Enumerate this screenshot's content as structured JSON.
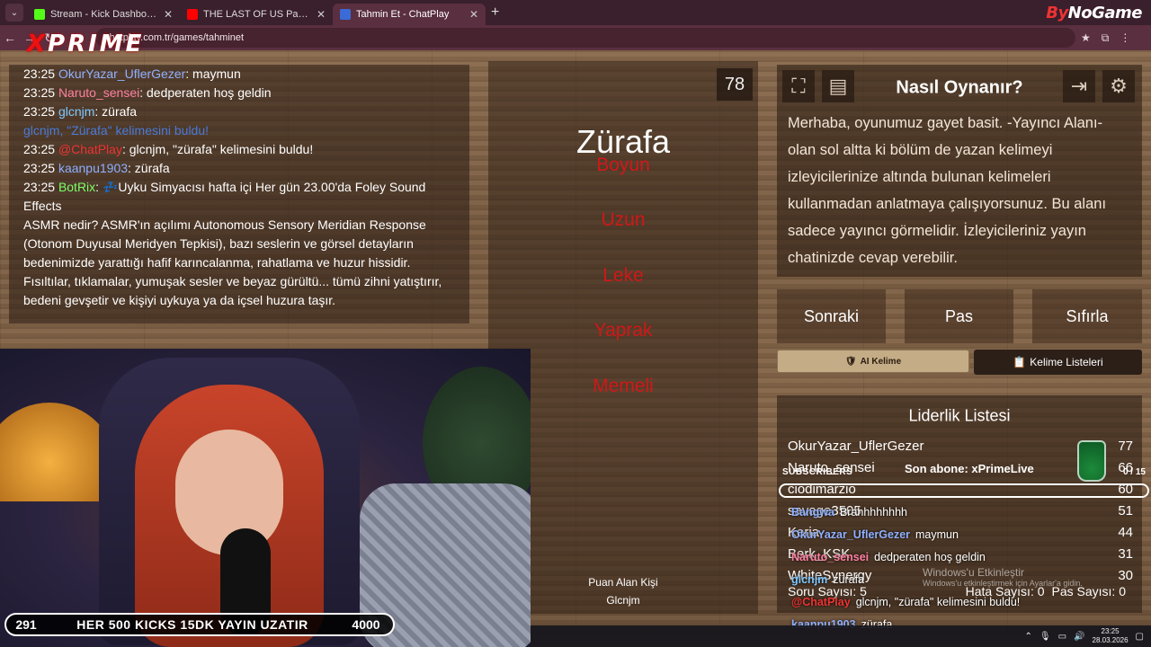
{
  "browser": {
    "tabs": [
      {
        "label": "Stream - Kick Dashboard",
        "icon": "kick-icon",
        "color": "#53fc18",
        "active": false
      },
      {
        "label": "THE LAST OF US Part II Am",
        "icon": "youtube-icon",
        "color": "#ff0000",
        "active": false
      },
      {
        "label": "Tahmin Et - ChatPlay",
        "icon": "chatplay-icon",
        "color": "#3a6bd8",
        "active": true
      }
    ],
    "url": "chatplay.com.tr/games/tahminet",
    "brand_prefix": "By",
    "brand_suffix": "NoGame"
  },
  "overlay_logo": {
    "x": "X",
    "rest": "PRIME"
  },
  "chat": [
    {
      "time": "23:25",
      "user": "OkurYazar_UflerGezer",
      "color": "#8fb0ff",
      "text": ": maymun"
    },
    {
      "time": "23:25",
      "user": "Naruto_sensei",
      "color": "#ff7fa0",
      "text": ": dedperaten hoş geldin"
    },
    {
      "time": "23:25",
      "user": "glcnjm",
      "color": "#7fc8ff",
      "text": ": zürafa"
    },
    {
      "time": "",
      "user": "glcnjm, \"Zürafa\" kelimesini buldu!",
      "color": "#4a7ad8",
      "text": ""
    },
    {
      "time": "23:25",
      "user": "@ChatPlay",
      "color": "#e33",
      "text": ": glcnjm, \"zürafa\" kelimesini buldu!"
    },
    {
      "time": "23:25",
      "user": "kaanpu1903",
      "color": "#8fb0ff",
      "text": ": zürafa"
    },
    {
      "time": "23:25",
      "user": "BotRix",
      "color": "#7dff6a",
      "text": ": 💤Uyku Simyacısı hafta içi Her gün 23.00'da Foley Sound Effects"
    },
    {
      "time": "",
      "user": "",
      "color": "#fff",
      "text": "ASMR nedir? ASMR'ın açılımı Autonomous Sensory Meridian Response (Otonom Duyusal Meridyen Tepkisi), bazı seslerin ve görsel detayların bedenimizde yarattığı hafif karıncalanma, rahatlama ve huzur hissidir. Fısıltılar, tıklamalar, yumuşak sesler ve beyaz gürültü... tümü zihni yatıştırır, bedeni gevşetir ve kişiyi uykuya ya da içsel huzura taşır."
    }
  ],
  "game": {
    "count": "78",
    "word": "Zürafa",
    "taboo": [
      "Boyun",
      "Uzun",
      "Leke",
      "Yaprak",
      "Memeli"
    ],
    "point_label": "Puan Alan Kişi",
    "point_user": "Glcnjm"
  },
  "howto": {
    "title": "Nasıl Oynanır?",
    "text": "Merhaba, oyunumuz gayet basit. -Yayıncı Alanı- olan sol altta ki bölüm de yazan kelimeyi izleyicilerinize altında bulunan kelimeleri kullanmadan anlatmaya çalışıyorsunuz. Bu alanı sadece yayıncı görmelidir. İzleyicileriniz yayın chatinizde cevap verebilir."
  },
  "buttons": {
    "next": "Sonraki",
    "pass": "Pas",
    "reset": "Sıfırla",
    "ai_word": "AI Kelime",
    "word_lists": "Kelime Listeleri"
  },
  "leaderboard": {
    "title": "Liderlik Listesi",
    "rows": [
      {
        "name": "OkurYazar_UflerGezer",
        "score": "77"
      },
      {
        "name": "Naruto_sensei",
        "score": "66"
      },
      {
        "name": "ciodimarzio",
        "score": "60"
      },
      {
        "name": "savage3505",
        "score": "51"
      },
      {
        "name": "Keria",
        "score": "44"
      },
      {
        "name": "Berk_KSK",
        "score": "31"
      },
      {
        "name": "WhiteSynergy",
        "score": "30"
      }
    ],
    "question_count": "Soru Sayısı: 5",
    "error_count": "Hata Sayısı: 0",
    "pass_count": "Pas Sayısı: 0"
  },
  "stream_overlay": {
    "kick_left": "291",
    "kick_text": "HER 500 KICKS 15DK YAYIN UZATIR",
    "kick_right": "4000",
    "subs_label": "SUBSCRIBERS",
    "last_sub": "Son abone: xPrimeLive",
    "subs_count": "0 / 15",
    "chat": [
      {
        "user": "Bangwa",
        "color": "#8fb0ff",
        "text": "Brahhhhhhhh"
      },
      {
        "user": "OkurYazar_UflerGezer",
        "color": "#8fb0ff",
        "text": "maymun"
      },
      {
        "user": "Naruto_sensei",
        "color": "#ff7fa0",
        "text": "dedperaten hoş geldin"
      },
      {
        "user": "glcnjm",
        "color": "#7fc8ff",
        "text": "zürafa"
      },
      {
        "user": "@ChatPlay",
        "color": "#e33",
        "text": "glcnjm, \"zürafa\" kelimesini buldu!"
      },
      {
        "user": "kaanpu1903",
        "color": "#8fb0ff",
        "text": "zürafa"
      }
    ],
    "windows_activate": "Windows'u Etkinleştir",
    "windows_activate_sub": "Windows'u etkinleştirmek için Ayarlar'a gidin.",
    "clock_time": "23:25",
    "clock_date": "28.03.2026"
  }
}
